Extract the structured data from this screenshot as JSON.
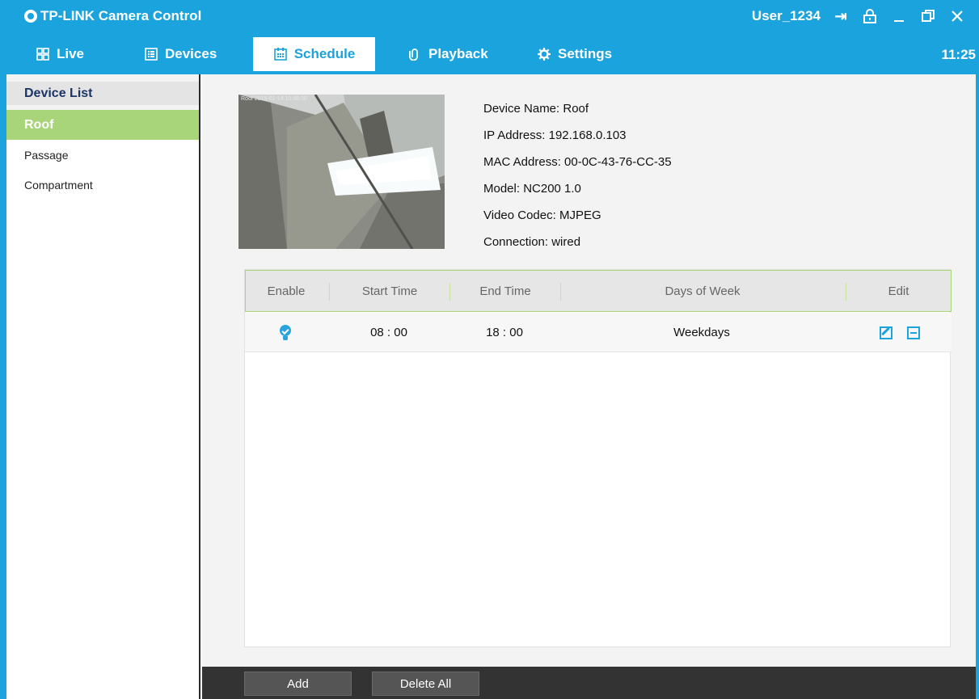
{
  "window": {
    "title": "TP-LINK Camera Control",
    "user": "User_1234",
    "logout_icon": "logout-icon",
    "lock_icon": "lock-icon",
    "minimize_icon": "minimize-icon",
    "restore_icon": "restore-icon",
    "close_icon": "close-icon"
  },
  "nav": {
    "tabs": [
      {
        "label": "Live",
        "icon": "grid-icon"
      },
      {
        "label": "Devices",
        "icon": "list-icon"
      },
      {
        "label": "Schedule",
        "icon": "calendar-icon"
      },
      {
        "label": "Playback",
        "icon": "clip-icon"
      },
      {
        "label": "Settings",
        "icon": "gear-icon"
      }
    ],
    "active": "Schedule",
    "clock": "11:25"
  },
  "sidebar": {
    "header": "Device List",
    "devices": [
      "Roof",
      "Passage",
      "Compartment"
    ],
    "selected": "Roof"
  },
  "device": {
    "preview_timestamp": "Roof 2015-01-14 10:48:30",
    "name": "Device Name: Roof",
    "ip": "IP Address: 192.168.0.103",
    "mac": "MAC Address: 00-0C-43-76-CC-35",
    "model": "Model: NC200 1.0",
    "codec": "Video Codec: MJPEG",
    "connection": "Connection: wired"
  },
  "schedule": {
    "columns": [
      "Enable",
      "Start Time",
      "End Time",
      "Days of Week",
      "Edit"
    ],
    "rows": [
      {
        "enabled": true,
        "start": "08 : 00",
        "end": "18 : 00",
        "days": "Weekdays"
      }
    ]
  },
  "footer": {
    "add_label": "Add",
    "delete_all_label": "Delete All"
  },
  "colors": {
    "accent": "#1aa3dc",
    "selected_item": "#a8d47a",
    "footer_bg": "#333333"
  }
}
